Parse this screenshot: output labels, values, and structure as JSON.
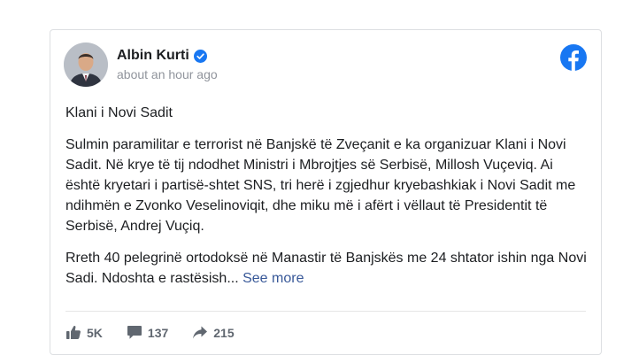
{
  "post": {
    "author": "Albin Kurti",
    "timestamp": "about an hour ago",
    "paragraphs": [
      "Klani i Novi Sadit",
      "Sulmin paramilitar e terrorist në Banjskë të Zveçanit e ka organizuar Klani i Novi Sadit. Në krye të tij ndodhet Ministri i Mbrojtjes së Serbisë, Millosh Vuçeviq. Ai është kryetari i partisë-shtet SNS, tri herë i zgjedhur kryebashkiak i Novi Sadit me ndihmën e Zvonko Veselinoviqit, dhe miku më i afërt i vëllaut të Presidentit të Serbisë, Andrej Vuçiq."
    ],
    "truncated_paragraph": "Rreth 40 pelegrinë ortodoksë në Manastir të Banjskës me 24 shtator ishin nga Novi Sadi. Ndoshta e rastësish...",
    "see_more_label": "See more"
  },
  "stats": {
    "likes": "5K",
    "comments": "137",
    "shares": "215"
  },
  "icons": {
    "verified": "verified-badge-icon",
    "platform": "facebook-logo-icon",
    "like": "thumbs-up-icon",
    "comment": "comment-bubble-icon",
    "share": "share-arrow-icon"
  },
  "colors": {
    "facebook_blue": "#1877f2",
    "link": "#385898",
    "verified": "#1877f2",
    "muted_text": "#90949c"
  }
}
